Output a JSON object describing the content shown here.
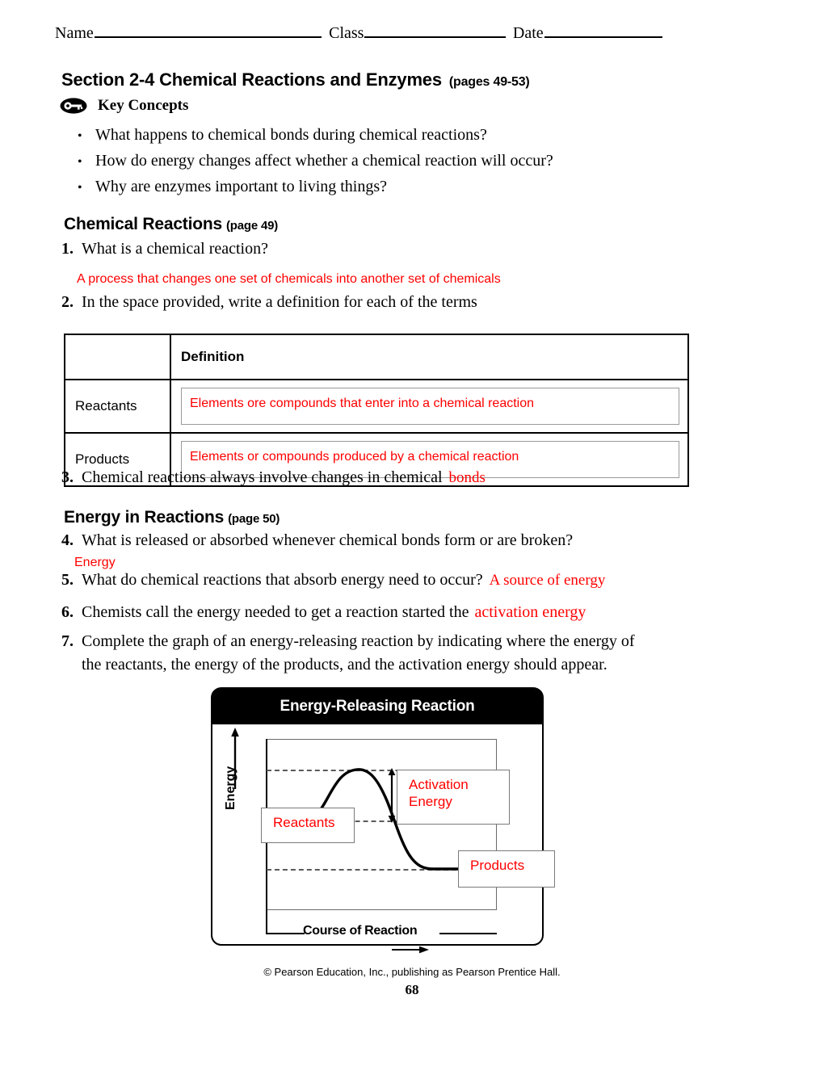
{
  "header": {
    "name_label": "Name",
    "class_label": "Class",
    "date_label": "Date"
  },
  "section": {
    "title": "Section 2-4  Chemical Reactions and Enzymes",
    "pages": "(pages  49-53)",
    "key_concepts_label": "Key Concepts",
    "key_icon": "key-icon",
    "bullets": [
      "What happens to chemical bonds during chemical reactions?",
      "How do energy changes affect whether a chemical reaction will occur?",
      "Why are enzymes important to living things?"
    ],
    "bullet_marker": "•"
  },
  "chemical_reactions": {
    "heading": "Chemical Reactions",
    "page_ref": "(page 49)",
    "q1": {
      "num": "1.",
      "text": "What is a chemical reaction?",
      "answer": "A process that changes one set of chemicals into another set of chemicals"
    },
    "q2": {
      "num": "2.",
      "text": "In the space provided, write a definition for each of the terms"
    },
    "table": {
      "header_blank": "",
      "header_definition": "Definition",
      "rows": [
        {
          "term": "Reactants",
          "definition": "Elements ore compounds that enter into a chemical reaction"
        },
        {
          "term": "Products",
          "definition": "Elements or compounds produced by a chemical reaction"
        }
      ]
    },
    "q3": {
      "num": "3.",
      "text": "Chemical reactions always involve changes in chemical",
      "answer": "bonds"
    }
  },
  "energy_in_reactions": {
    "heading": "Energy in Reactions",
    "page_ref": "(page 50)",
    "q4": {
      "num": "4.",
      "text": "What is released or absorbed whenever chemical bonds form or are broken?",
      "answer": "Energy"
    },
    "q5": {
      "num": "5.",
      "text": "What do chemical reactions that absorb energy need to occur?",
      "answer": "A source of energy"
    },
    "q6": {
      "num": "6.",
      "text": "Chemists call the energy needed to get a reaction started the",
      "answer": "activation energy"
    },
    "q7": {
      "num": "7.",
      "text": "Complete the graph of an energy-releasing reaction by indicating where the energy of the reactants, the energy of the products, and the activation energy should appear."
    }
  },
  "chart_data": {
    "type": "line",
    "title": "Energy-Releasing Reaction",
    "xlabel": "Course of Reaction",
    "ylabel": "Energy",
    "grid": false,
    "legend": "none",
    "axis_arrows": {
      "y": "upward-arrow",
      "x": "rightward-arrow"
    },
    "levels": {
      "peak": 0.72,
      "reactants": 0.42,
      "products": 0.14
    },
    "x": [
      0.0,
      0.08,
      0.16,
      0.24,
      0.32,
      0.4,
      0.48,
      0.56,
      0.64,
      0.72,
      0.8,
      0.88,
      1.0
    ],
    "y": [
      0.42,
      0.42,
      0.43,
      0.5,
      0.61,
      0.7,
      0.72,
      0.69,
      0.57,
      0.38,
      0.21,
      0.15,
      0.14
    ],
    "annotations": [
      {
        "name": "activation-energy",
        "label": "Activation\nEnergy",
        "from": 0.42,
        "to": 0.72,
        "marker": "double-headed-arrow"
      },
      {
        "name": "reactants",
        "label": "Reactants",
        "level": 0.42
      },
      {
        "name": "products",
        "label": "Products",
        "level": 0.14
      }
    ],
    "callouts": {
      "activation_energy": "Activation Energy",
      "activation_energy_line1": "Activation",
      "activation_energy_line2": "Energy",
      "reactants": "Reactants",
      "products": "Products"
    },
    "colors": {
      "curve": "#000000",
      "level_lines": "#5a5a5a",
      "callout_text": "#FF0000",
      "title_bar": "#000000",
      "title_text": "#FFFFFF"
    }
  },
  "footer": {
    "credit": "© Pearson Education, Inc., publishing as Pearson Prentice Hall.",
    "page_number": "68"
  }
}
